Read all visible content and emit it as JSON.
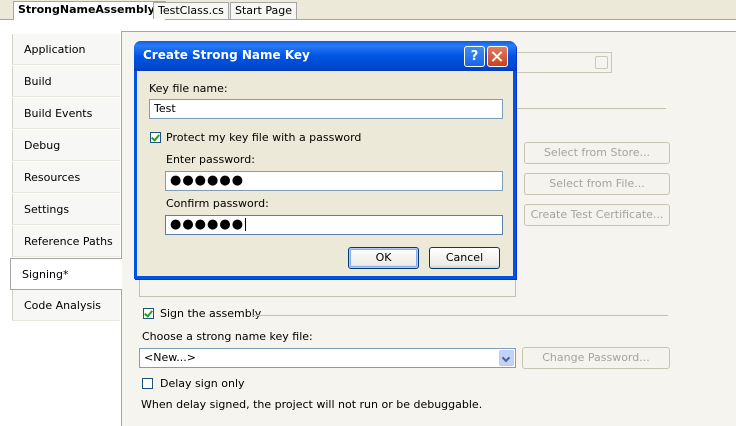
{
  "doc_tabs": [
    {
      "label": "StrongNameAssembly*",
      "active": true
    },
    {
      "label": "TestClass.cs",
      "active": false
    },
    {
      "label": "Start Page",
      "active": false
    }
  ],
  "side_tabs": [
    {
      "label": "Application"
    },
    {
      "label": "Build"
    },
    {
      "label": "Build Events"
    },
    {
      "label": "Debug"
    },
    {
      "label": "Resources"
    },
    {
      "label": "Settings"
    },
    {
      "label": "Reference Paths"
    },
    {
      "label": "Signing*",
      "active": true
    },
    {
      "label": "Code Analysis"
    }
  ],
  "signing": {
    "select_from_store": "Select from Store...",
    "select_from_file": "Select from File...",
    "create_test_certificate": "Create Test Certificate...",
    "sign_assembly_label": "Sign the assembly",
    "sign_assembly_checked": true,
    "choose_key_label": "Choose a strong name key file:",
    "key_file_value": "<New...>",
    "change_password": "Change Password...",
    "delay_sign_label": "Delay sign only",
    "delay_sign_checked": false,
    "delay_note": "When delay signed, the project will not run or be debuggable."
  },
  "dialog": {
    "title": "Create Strong Name Key",
    "help_glyph": "?",
    "key_file_name_label": "Key file name:",
    "key_file_name_value": "Test",
    "protect_label": "Protect my key file with a password",
    "protect_checked": true,
    "enter_password_label": "Enter password:",
    "enter_password_value": "●●●●●●",
    "confirm_password_label": "Confirm password:",
    "confirm_password_value": "●●●●●●",
    "ok_label": "OK",
    "cancel_label": "Cancel"
  },
  "colors": {
    "title_bar": "#0054e3",
    "panel_bg": "#f5f4ef",
    "dialog_bg": "#ece9d8",
    "check_green": "#21a121"
  }
}
